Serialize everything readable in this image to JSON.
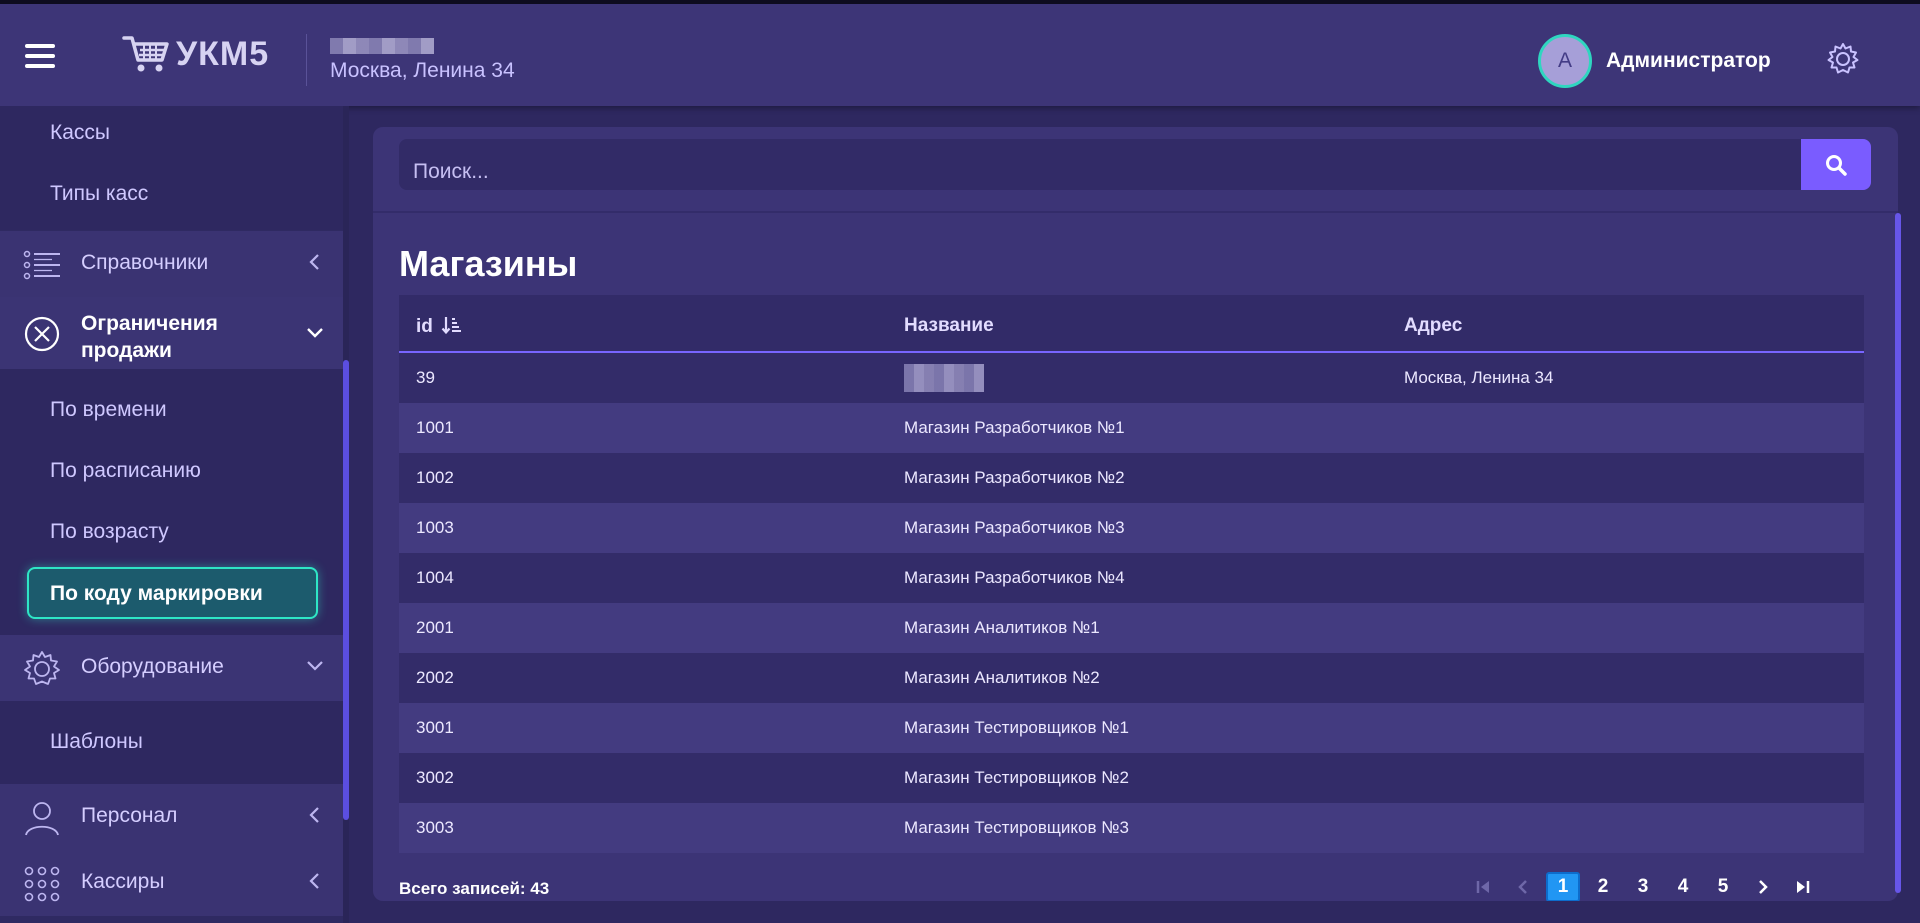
{
  "header": {
    "logo_text": "УКМ5",
    "store_address": "Москва, Ленина 34",
    "user_initial": "A",
    "user_name": "Администратор"
  },
  "sidebar": {
    "top_items": [
      "Кассы",
      "Типы касс"
    ],
    "groups": {
      "reference": "Справочники",
      "restrictions": "Ограничения продажи",
      "equipment": "Оборудование",
      "personnel": "Персонал",
      "cashiers": "Кассиры"
    },
    "restriction_items": [
      "По времени",
      "По расписанию",
      "По возрасту"
    ],
    "active_item": "По коду маркировки",
    "equipment_items": [
      "Шаблоны"
    ]
  },
  "search": {
    "placeholder": "Поиск..."
  },
  "page": {
    "title": "Магазины"
  },
  "table": {
    "headers": {
      "id": "id",
      "name": "Название",
      "address": "Адрес"
    },
    "rows": [
      {
        "id": "39",
        "name": "",
        "address": "Москва, Ленина 34"
      },
      {
        "id": "1001",
        "name": "Магазин Разработчиков №1",
        "address": ""
      },
      {
        "id": "1002",
        "name": "Магазин Разработчиков №2",
        "address": ""
      },
      {
        "id": "1003",
        "name": "Магазин Разработчиков №3",
        "address": ""
      },
      {
        "id": "1004",
        "name": "Магазин Разработчиков №4",
        "address": ""
      },
      {
        "id": "2001",
        "name": "Магазин Аналитиков №1",
        "address": ""
      },
      {
        "id": "2002",
        "name": "Магазин Аналитиков №2",
        "address": ""
      },
      {
        "id": "3001",
        "name": "Магазин Тестировщиков №1",
        "address": ""
      },
      {
        "id": "3002",
        "name": "Магазин Тестировщиков №2",
        "address": ""
      },
      {
        "id": "3003",
        "name": "Магазин Тестировщиков №3",
        "address": ""
      }
    ]
  },
  "footer": {
    "total": "Всего записей: 43",
    "pages": [
      "1",
      "2",
      "3",
      "4",
      "5"
    ],
    "current_page": "1"
  },
  "colors": {
    "accent": "#7a5cff",
    "active_border": "#2ee6c6",
    "page_active": "#2196f3"
  }
}
